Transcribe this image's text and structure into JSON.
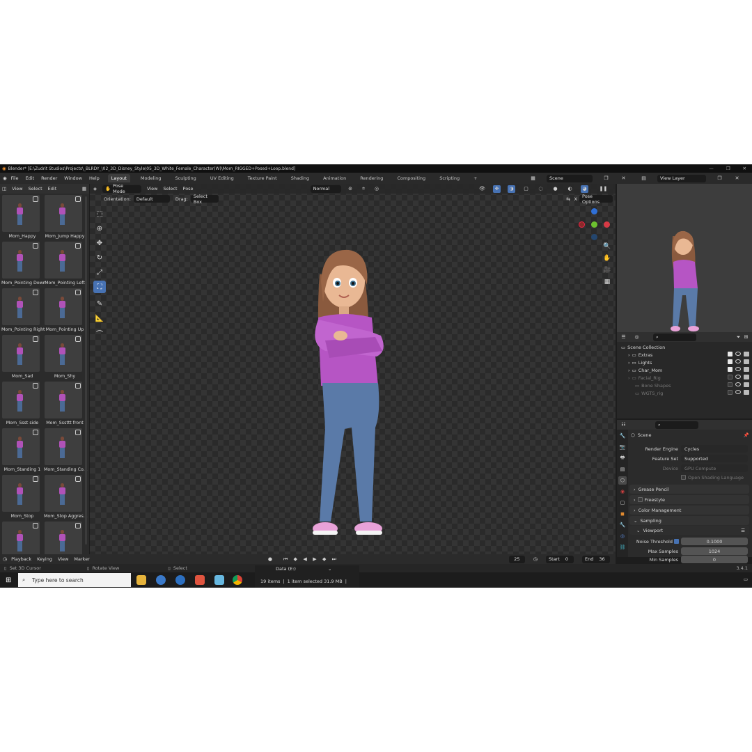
{
  "window": {
    "title": "Blender* [E:\\Zudrit Studios\\Projects\\_BLRDY_\\02_3D_Disney_Style\\05_3D_White_Female_Character(W)\\Mom_RIGGED+Posed+Loop.blend]"
  },
  "menu": {
    "items": [
      "File",
      "Edit",
      "Render",
      "Window",
      "Help"
    ]
  },
  "workspaces": [
    "Layout",
    "Modeling",
    "Sculpting",
    "UV Editing",
    "Texture Paint",
    "Shading",
    "Animation",
    "Rendering",
    "Compositing",
    "Scripting",
    "+"
  ],
  "top_right": {
    "scene": "Scene",
    "view_layer": "View Layer"
  },
  "asset_browser": {
    "menus": [
      "View",
      "Select",
      "Edit"
    ],
    "assets": [
      "Mom_Happy",
      "Mom_Jump Happy",
      "Mom_Pointing Down",
      "Mom_Pointing Left",
      "Mom_Pointing Right",
      "Mom_Pointing Up",
      "Mom_Sad",
      "Mom_Shy",
      "Mom_Ssst side",
      "Mom_Sssttt front",
      "Mom_Standing 1",
      "Mom_Standing Co...",
      "Mom_Stop",
      "Mom_Stop Aggres...",
      "",
      ""
    ]
  },
  "viewport": {
    "mode": "Pose Mode",
    "menus": [
      "View",
      "Select",
      "Pose"
    ],
    "orientation_label": "Orientation:",
    "orientation": "Default",
    "drag_label": "Drag:",
    "drag": "Select Box",
    "transform": "Normal",
    "pose_options": "Pose Options",
    "x_label": "X"
  },
  "outliner": {
    "items": [
      {
        "label": "Scene Collection",
        "indent": 0,
        "visible": true
      },
      {
        "label": "Extras",
        "indent": 1,
        "visible": true
      },
      {
        "label": "Lights",
        "indent": 1,
        "visible": true
      },
      {
        "label": "Char_Mom",
        "indent": 1,
        "visible": true
      },
      {
        "label": "Facial_Rig",
        "indent": 1,
        "visible": false
      },
      {
        "label": "Bone Shapes",
        "indent": 2,
        "visible": false
      },
      {
        "label": "WGTS_rig",
        "indent": 2,
        "visible": false
      }
    ]
  },
  "properties": {
    "context": "Scene",
    "render_engine_label": "Render Engine",
    "render_engine": "Cycles",
    "feature_set_label": "Feature Set",
    "feature_set": "Supported",
    "device_label": "Device",
    "device": "GPU Compute",
    "osl_label": "Open Shading Language",
    "panels": [
      "Grease Pencil",
      "Freestyle",
      "Color Management",
      "Sampling",
      "Viewport"
    ],
    "noise_threshold_label": "Noise Threshold",
    "noise_threshold": "0.1000",
    "max_samples_label": "Max Samples",
    "max_samples": "1024",
    "min_samples_label": "Min Samples",
    "min_samples": "0"
  },
  "timeline": {
    "menus": [
      "Playback",
      "Keying",
      "View",
      "Marker"
    ],
    "current_frame": "25",
    "start_label": "Start",
    "start": "0",
    "end_label": "End",
    "end": "36"
  },
  "statusbar": {
    "left1": "Set 3D Cursor",
    "left2": "Rotate View",
    "left3": "Select",
    "version": "3.4.1"
  },
  "taskbar": {
    "search_placeholder": "Type here to search",
    "explorer_title": "Data (E:)",
    "explorer_items": "19 items",
    "explorer_selected": "1 item selected  31.9 MB"
  },
  "colors": {
    "accent": "#4772b3",
    "top": "#b655c4",
    "jeans": "#5a7aa8",
    "hair": "#8a5a3e",
    "skin": "#e9b894",
    "shoes": "#e8a2d8"
  }
}
